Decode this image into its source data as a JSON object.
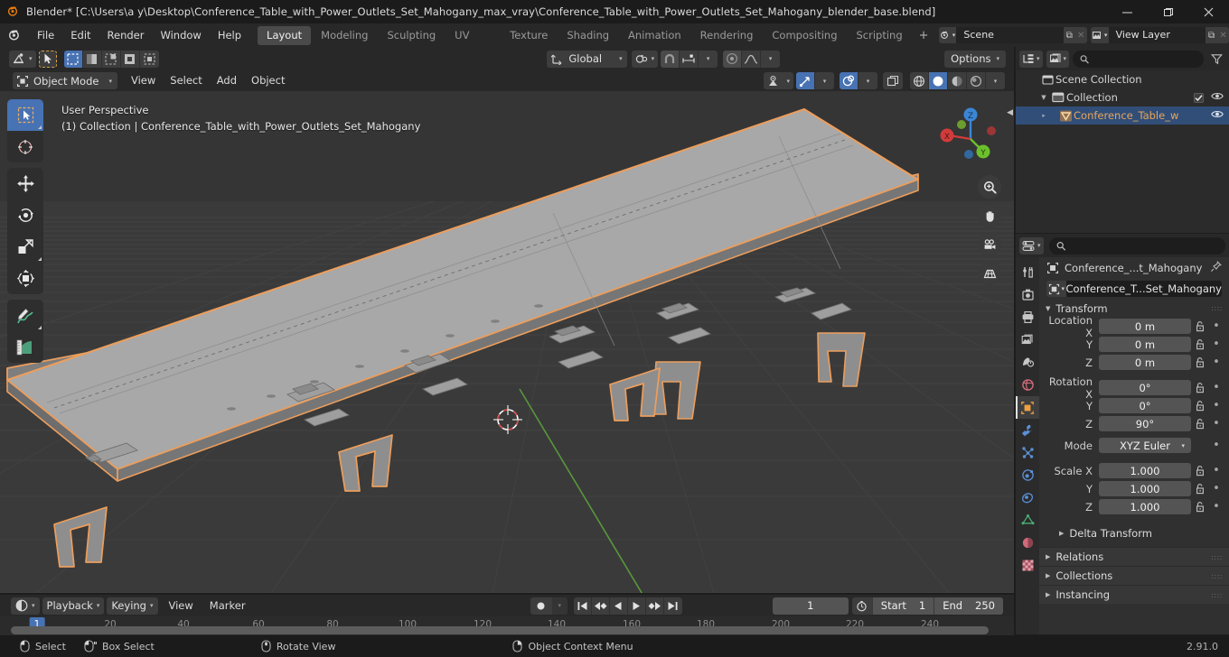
{
  "window": {
    "title": "Blender* [C:\\Users\\a y\\Desktop\\Conference_Table_with_Power_Outlets_Set_Mahogany_max_vray\\Conference_Table_with_Power_Outlets_Set_Mahogany_blender_base.blend]",
    "minimize": "–",
    "maximize": "❐",
    "close": "✕"
  },
  "menu": {
    "items": [
      "File",
      "Edit",
      "Render",
      "Window",
      "Help"
    ]
  },
  "workspaces": {
    "tabs": [
      "Layout",
      "Modeling",
      "Sculpting",
      "UV Editing",
      "Texture Paint",
      "Shading",
      "Animation",
      "Rendering",
      "Compositing",
      "Scripting"
    ],
    "active": "Layout",
    "add_label": "+"
  },
  "scene": {
    "name": "Scene",
    "new_label": "⧉",
    "remove_label": "✕"
  },
  "viewlayer": {
    "name": "View Layer",
    "new_label": "⧉",
    "remove_label": "✕"
  },
  "viewport": {
    "mode": "Object Mode",
    "menus": [
      "View",
      "Select",
      "Add",
      "Object"
    ],
    "transform_orientation": "Global",
    "options_label": "Options",
    "overlay_line1": "User Perspective",
    "overlay_line2": "(1) Collection | Conference_Table_with_Power_Outlets_Set_Mahogany",
    "gizmo_axes": [
      "X",
      "Y",
      "Z"
    ],
    "toolbar_tools": [
      "tweak-select-tool",
      "cursor-tool",
      "move-tool",
      "rotate-tool",
      "scale-tool",
      "transform-tool",
      "annotate-tool",
      "measure-tool"
    ],
    "nav_buttons": [
      "zoom-icon",
      "hand-icon",
      "camera-icon",
      "grid-icon"
    ]
  },
  "outliner": {
    "display_mode": "view-layer-icon",
    "filter_icon": "filter-icon",
    "search_placeholder": "",
    "rows": [
      {
        "label": "Scene Collection",
        "type": "scene-collection",
        "indent": 0,
        "expandable": false,
        "selected": false,
        "checkbox": false,
        "eye": false
      },
      {
        "label": "Collection",
        "type": "collection",
        "indent": 1,
        "expandable": true,
        "expanded": true,
        "selected": false,
        "checkbox": true,
        "eye": true
      },
      {
        "label": "Conference_Table_w",
        "type": "mesh-object",
        "indent": 2,
        "expandable": true,
        "expanded": false,
        "selected": true,
        "checkbox": false,
        "eye": true
      }
    ]
  },
  "properties": {
    "search_placeholder": "",
    "tabs": [
      "tool-icon",
      "render-icon",
      "output-icon",
      "view-layer-icon",
      "scene-icon",
      "world-icon",
      "object-icon",
      "modifier-icon",
      "particles-icon",
      "physics-icon",
      "constraint-icon",
      "data-icon",
      "material-icon",
      "texture-icon"
    ],
    "active_tab": "object-icon",
    "breadcrumb": "Conference_...t_Mahogany",
    "pin_icon": "pin-icon",
    "object_name": "Conference_T...Set_Mahogany",
    "transform": {
      "title": "Transform",
      "location": {
        "label": "Location",
        "axes": [
          "X",
          "Y",
          "Z"
        ],
        "values": [
          "0 m",
          "0 m",
          "0 m"
        ]
      },
      "rotation": {
        "label": "Rotation",
        "axes": [
          "X",
          "Y",
          "Z"
        ],
        "values": [
          "0°",
          "0°",
          "90°"
        ]
      },
      "mode": {
        "label": "Mode",
        "value": "XYZ Euler"
      },
      "scale": {
        "label": "Scale",
        "axes": [
          "X",
          "Y",
          "Z"
        ],
        "values": [
          "1.000",
          "1.000",
          "1.000"
        ]
      },
      "delta_transform": "Delta Transform"
    },
    "panels": [
      "Relations",
      "Collections",
      "Instancing"
    ]
  },
  "timeline": {
    "editor_icon": "timeline-icon",
    "playback_label": "Playback",
    "keying_label": "Keying",
    "menus": [
      "View",
      "Marker"
    ],
    "record_icon": "record-icon",
    "transport": [
      "jump-start-icon",
      "prev-keyframe-icon",
      "play-reverse-icon",
      "play-icon",
      "next-keyframe-icon",
      "jump-end-icon"
    ],
    "current_frame": "1",
    "clock_icon": "clock-icon",
    "start_label": "Start",
    "start_value": "1",
    "end_label": "End",
    "end_value": "250",
    "ticks": [
      "20",
      "40",
      "60",
      "80",
      "100",
      "120",
      "140",
      "160",
      "180",
      "200",
      "220",
      "240"
    ],
    "cursor_label": "1"
  },
  "statusbar": {
    "items": [
      {
        "icon": "mouse-left-icon",
        "label": "Select"
      },
      {
        "icon": "mouse-left-drag-icon",
        "label": "Box Select"
      },
      {
        "icon": "mouse-middle-icon",
        "label": "Rotate View"
      },
      {
        "icon": "mouse-right-icon",
        "label": "Object Context Menu"
      }
    ],
    "version": "2.91.0"
  },
  "colors": {
    "accent_blue": "#4772b3",
    "selection_orange": "#ed9e5c",
    "object_orange": "#e8a55a",
    "viewport_bg": "#3a3a3a",
    "panel_bg": "#303030",
    "header_bg": "#282828"
  }
}
